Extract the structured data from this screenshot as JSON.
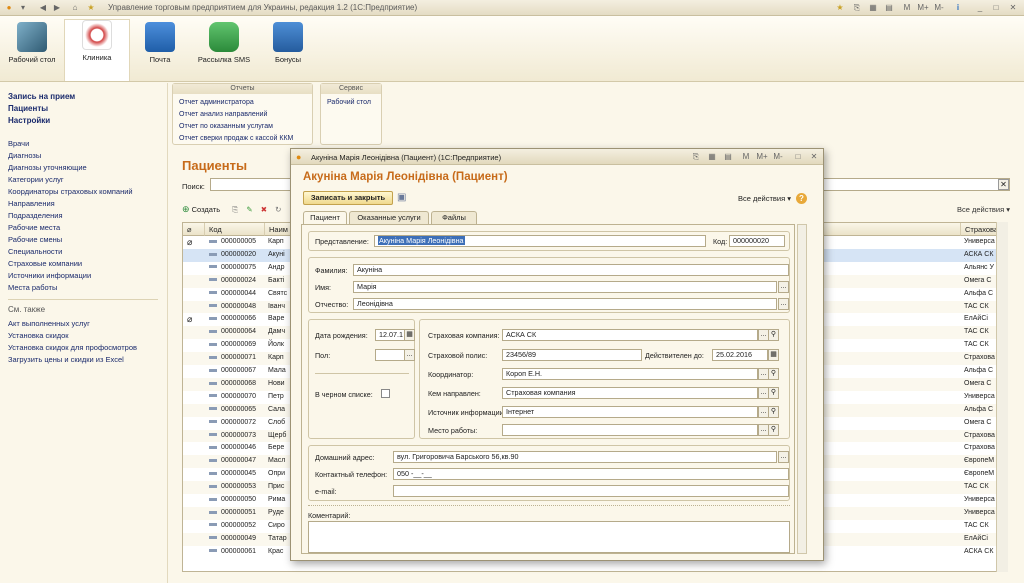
{
  "window": {
    "title": "Управление торговым предприятием для Украины, редакция 1.2  (1С:Предприятие)",
    "right_icons": [
      "M",
      "M+",
      "M-",
      "i"
    ]
  },
  "toolbar": {
    "items": [
      {
        "label": "Рабочий стол",
        "color": "#3c6e8f"
      },
      {
        "label": "Клиника",
        "color": "#c23b3b"
      },
      {
        "label": "Почта",
        "color": "#2a6fc1"
      },
      {
        "label": "Рассылка SMS",
        "color": "#39a84a"
      },
      {
        "label": "Бонусы",
        "color": "#2f6fb5"
      }
    ]
  },
  "left_panel": {
    "top_links": [
      "Запись на прием",
      "Пациенты",
      "Настройки"
    ],
    "links": [
      "Врачи",
      "Диагнозы",
      "Диагнозы уточняющие",
      "Категории услуг",
      "Координаторы страховых компаний",
      "Направления",
      "Подразделения",
      "Рабочие места",
      "Рабочие смены",
      "Специальности",
      "Страховые компании",
      "Источники информации",
      "Места работы"
    ],
    "see_also_title": "См. также",
    "see_also": [
      "Акт выполненных услуг",
      "Установка скидок",
      "Установка скидок для профосмотров",
      "Загрузить цены и скидки из Excel"
    ]
  },
  "reports": {
    "title": "Отчеты",
    "items": [
      "Отчет администратора",
      "Отчет анализ направлений",
      "Отчет по оказанным услугам",
      "Отчет сверки продаж с кассой ККМ"
    ]
  },
  "service": {
    "title": "Сервис",
    "items": [
      "Рабочий стол"
    ]
  },
  "list": {
    "title": "Пациенты",
    "search_label": "Поиск:",
    "create_label": "Создать",
    "all_actions": "Все действия ▾",
    "col_code": "Код",
    "col_name": "Наим",
    "col_ins": "Страхова",
    "rows": [
      {
        "code": "000000005",
        "name": "Карп",
        "ins": "Универса"
      },
      {
        "code": "000000020",
        "name": "Акуні",
        "ins": "АСКА СК"
      },
      {
        "code": "000000075",
        "name": "Андр",
        "ins": "Альянс У"
      },
      {
        "code": "000000024",
        "name": "Бакті",
        "ins": "Омега С"
      },
      {
        "code": "000000044",
        "name": "Святс",
        "ins": "Альфа С"
      },
      {
        "code": "000000048",
        "name": "Іванч",
        "ins": "ТАС СК"
      },
      {
        "code": "000000066",
        "name": "Варе",
        "ins": "ЕлАйСі"
      },
      {
        "code": "000000064",
        "name": "Дамч",
        "ins": "ТАС СК"
      },
      {
        "code": "000000069",
        "name": "Йолк",
        "ins": "ТАС СК"
      },
      {
        "code": "000000071",
        "name": "Карп",
        "ins": "Страхова"
      },
      {
        "code": "000000067",
        "name": "Мала",
        "ins": "Альфа С"
      },
      {
        "code": "000000068",
        "name": "Нови",
        "ins": "Омега С"
      },
      {
        "code": "000000070",
        "name": "Петр",
        "ins": "Универса"
      },
      {
        "code": "000000065",
        "name": "Сала",
        "ins": "Альфа С"
      },
      {
        "code": "000000072",
        "name": "Слоб",
        "ins": "Омега С"
      },
      {
        "code": "000000073",
        "name": "Щерб",
        "ins": "Страхова"
      },
      {
        "code": "000000046",
        "name": "Бере",
        "ins": "Страхова"
      },
      {
        "code": "000000047",
        "name": "Масл",
        "ins": "ЄвропеМ"
      },
      {
        "code": "000000045",
        "name": "Опри",
        "ins": "ЄвропеМ"
      },
      {
        "code": "000000053",
        "name": "Прис",
        "ins": "ТАС СК"
      },
      {
        "code": "000000050",
        "name": "Рима",
        "ins": "Универса"
      },
      {
        "code": "000000051",
        "name": "Руде",
        "ins": "Универса"
      },
      {
        "code": "000000052",
        "name": "Сиро",
        "ins": "ТАС СК"
      },
      {
        "code": "000000049",
        "name": "Татар",
        "ins": "ЕлАйСі"
      },
      {
        "code": "000000061",
        "name": "Крас",
        "ins": "АСКА СК"
      }
    ]
  },
  "modal": {
    "title": "Акуніна Марія Леонідівна (Пациент)  (1С:Предприятие)",
    "heading": "Акуніна Марія Леонідівна (Пациент)",
    "save_close": "Записать и закрыть",
    "all_actions": "Все действия ▾",
    "tabs": [
      "Пациент",
      "Оказанные услуги",
      "Файлы"
    ],
    "representation_label": "Представление:",
    "representation_value": "Акуніна Марія Леонідівна",
    "code_label": "Код:",
    "code_value": "000000020",
    "surname_label": "Фамилия:",
    "surname_value": "Акуніна",
    "name_label": "Имя:",
    "name_value": "Марія",
    "patronymic_label": "Отчество:",
    "patronymic_value": "Леонідівна",
    "birth_label": "Дата рождения:",
    "birth_value": "12.07.1",
    "gender_label": "Пол:",
    "gender_value": "",
    "blacklist_label": "В черном списке:",
    "ins_company_label": "Страховая компания:",
    "ins_company_value": "АСКА СК",
    "policy_label": "Страховой полис:",
    "policy_value": "23456/89",
    "valid_label": "Действителен до:",
    "valid_value": "25.02.2016",
    "coordinator_label": "Координатор:",
    "coordinator_value": "Короп Е.Н.",
    "referrer_label": "Кем направлен:",
    "referrer_value": "Страховая компания",
    "source_label": "Источник информации:",
    "source_value": "Інтернет",
    "workplace_label": "Место работы:",
    "workplace_value": "",
    "address_label": "Домашний адрес:",
    "address_value": "вул. Григоровича Барського 56,кв.90",
    "phone_label": "Контактный телефон:",
    "phone_value": "050 -__-__",
    "email_label": "e-mail:",
    "email_value": "",
    "comment_label": "Коментарий:"
  }
}
